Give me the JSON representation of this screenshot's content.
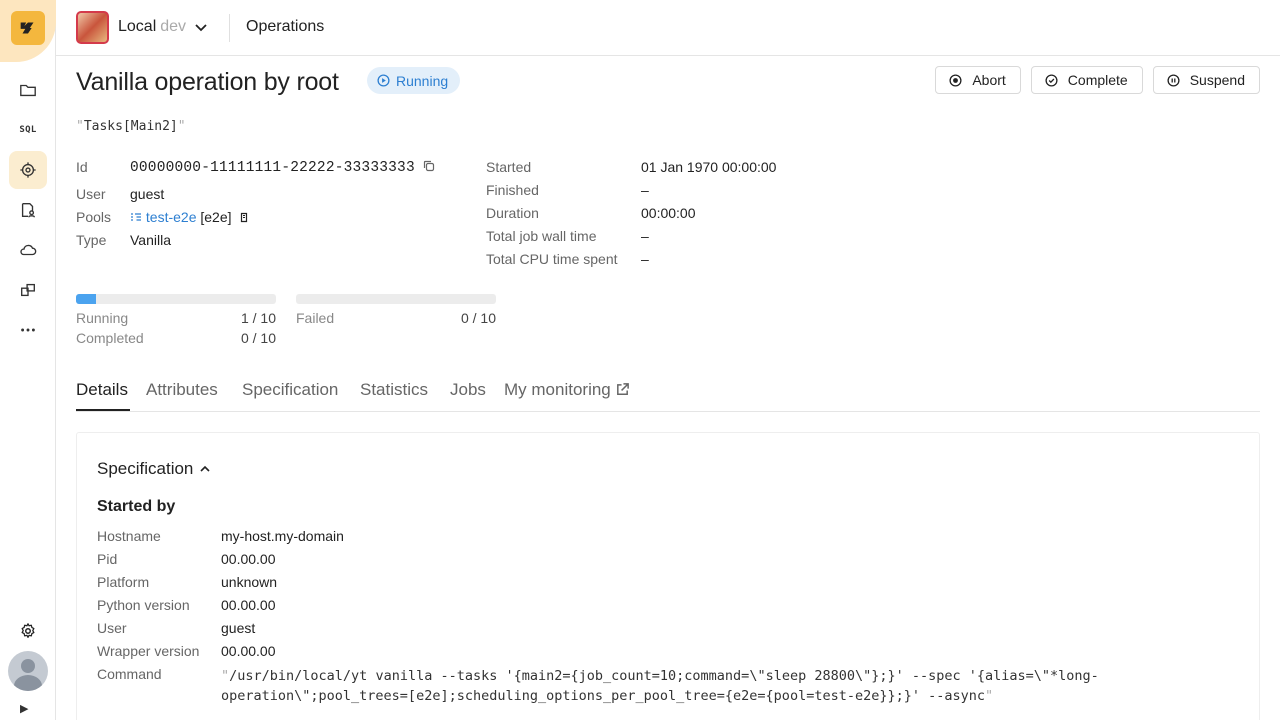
{
  "sidebar": {
    "logo_text": "y",
    "items": [
      {
        "name": "navigation",
        "icon": "folder-icon"
      },
      {
        "name": "queries",
        "label": "SQL",
        "icon": "sql-icon"
      },
      {
        "name": "operations",
        "icon": "operations-icon",
        "active": true
      },
      {
        "name": "accounts",
        "icon": "accounts-icon"
      },
      {
        "name": "system",
        "icon": "cloud-icon"
      },
      {
        "name": "components",
        "icon": "components-icon"
      },
      {
        "name": "more",
        "icon": "more-icon"
      }
    ],
    "settings_icon": "gear-icon",
    "expand_glyph": "▶"
  },
  "header": {
    "cluster_name": "Local",
    "cluster_env": "dev",
    "page_title": "Operations"
  },
  "operation": {
    "title": "Vanilla operation by root",
    "state": "Running",
    "title_attr": "Tasks[Main2]",
    "actions": {
      "abort": "Abort",
      "complete": "Complete",
      "suspend": "Suspend"
    },
    "meta_left": {
      "id_label": "Id",
      "id_value": "00000000-11111111-22222-33333333",
      "user_label": "User",
      "user_value": "guest",
      "pools_label": "Pools",
      "pool_name": "test-e2e",
      "pool_tree": "[e2e]",
      "type_label": "Type",
      "type_value": "Vanilla"
    },
    "meta_right": {
      "started_label": "Started",
      "started_value": "01 Jan 1970 00:00:00",
      "finished_label": "Finished",
      "finished_value": "–",
      "duration_label": "Duration",
      "duration_value": "00:00:00",
      "wall_label": "Total job wall time",
      "wall_value": "–",
      "cpu_label": "Total CPU time spent",
      "cpu_value": "–"
    },
    "progress": {
      "running_label": "Running",
      "running_value": "1  /  10",
      "running_fraction": 0.1,
      "completed_label": "Completed",
      "completed_value": "0  /  10",
      "failed_label": "Failed",
      "failed_value": "0  /  10",
      "failed_fraction": 0
    }
  },
  "tabs": [
    {
      "label": "Details",
      "active": true
    },
    {
      "label": "Attributes"
    },
    {
      "label": "Specification"
    },
    {
      "label": "Statistics"
    },
    {
      "label": "Jobs"
    },
    {
      "label": "My monitoring",
      "external": true
    }
  ],
  "details": {
    "section_title": "Specification",
    "started_by_title": "Started by",
    "fields": {
      "hostname_label": "Hostname",
      "hostname_value": "my-host.my-domain",
      "pid_label": "Pid",
      "pid_value": "00.00.00",
      "platform_label": "Platform",
      "platform_value": "unknown",
      "python_label": "Python version",
      "python_value": "00.00.00",
      "user_label": "User",
      "user_value": "guest",
      "wrapper_label": "Wrapper version",
      "wrapper_value": "00.00.00",
      "command_label": "Command",
      "command_line1": "/usr/bin/local/yt vanilla --tasks '{main2={job_count=10;command=\\\"sleep 28800\\\"};}' --spec '{alias=\\\"*long-",
      "command_line2": "operation\\\";pool_trees=[e2e];scheduling_options_per_pool_tree={e2e={pool=test-e2e}};}' --async"
    }
  },
  "colors": {
    "accent": "#2d7fd1",
    "progress_fill": "#4ba3ef",
    "badge_bg": "#e3effa",
    "logo_bg": "#f4b73e",
    "active_nav_bg": "#fbedd0"
  }
}
